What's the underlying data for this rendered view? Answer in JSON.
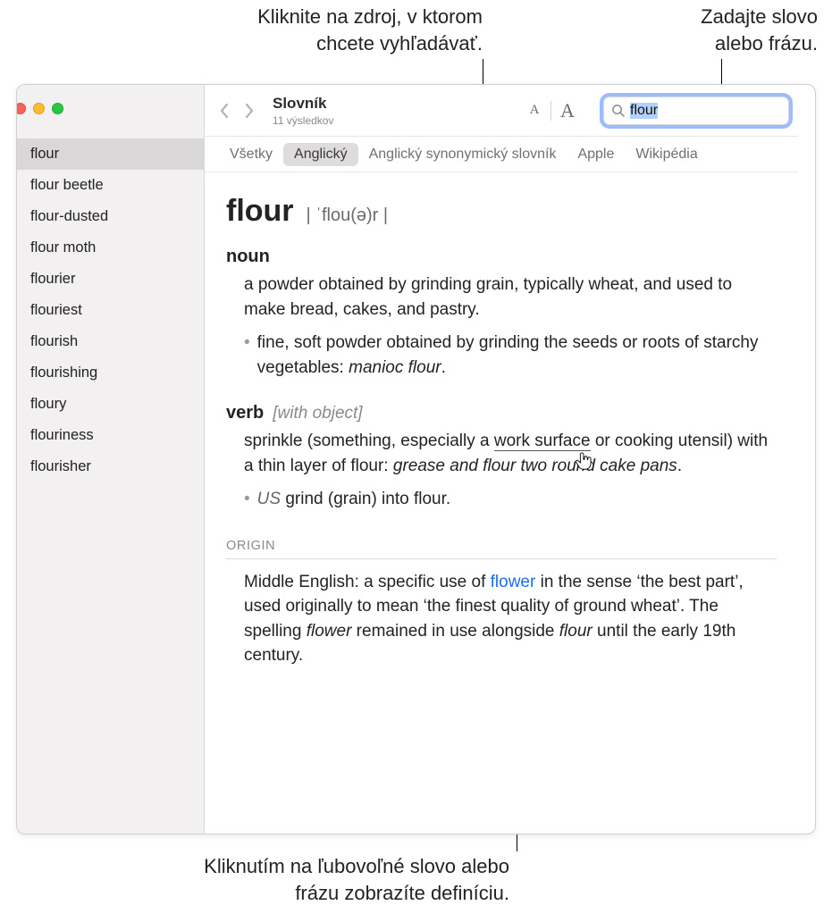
{
  "callouts": {
    "top_left": "Kliknite na zdroj, v ktorom\nchcete vyhľadávať.",
    "top_right": "Zadajte slovo\nalebo frázu.",
    "bottom": "Kliknutím na ľubovoľné slovo alebo\nfrázu zobrazíte definíciu."
  },
  "toolbar": {
    "title": "Slovník",
    "subtitle": "11 výsledkov",
    "font_small": "A",
    "font_large": "A"
  },
  "search": {
    "value": "flour"
  },
  "sources": [
    {
      "label": "Všetky",
      "active": false
    },
    {
      "label": "Anglický",
      "active": true
    },
    {
      "label": "Anglický synonymický slovník",
      "active": false
    },
    {
      "label": "Apple",
      "active": false
    },
    {
      "label": "Wikipédia",
      "active": false
    }
  ],
  "sidebar": {
    "items": [
      {
        "label": "flour",
        "selected": true
      },
      {
        "label": "flour beetle",
        "selected": false
      },
      {
        "label": "flour-dusted",
        "selected": false
      },
      {
        "label": "flour moth",
        "selected": false
      },
      {
        "label": "flourier",
        "selected": false
      },
      {
        "label": "flouriest",
        "selected": false
      },
      {
        "label": "flourish",
        "selected": false
      },
      {
        "label": "flourishing",
        "selected": false
      },
      {
        "label": "floury",
        "selected": false
      },
      {
        "label": "flouriness",
        "selected": false
      },
      {
        "label": "flourisher",
        "selected": false
      }
    ]
  },
  "entry": {
    "headword": "flour",
    "pronunciation": "| ˈflou(ə)r |",
    "blocks": [
      {
        "pos": "noun",
        "qualifier": "",
        "sense": "a powder obtained by grinding grain, typically wheat, and used to make bread, cakes, and pastry.",
        "subs": [
          {
            "lead": "",
            "text": "fine, soft powder obtained by grinding the seeds or roots of starchy vegetables: ",
            "example": "manioc flour",
            "tail": "."
          }
        ]
      },
      {
        "pos": "verb",
        "qualifier": "[with object]",
        "sense_pre": "sprinkle (something, especially a ",
        "sense_link": "work surface",
        "sense_post": " or cooking utensil) with a thin layer of flour: ",
        "sense_example": "grease and flour two round cake pans",
        "sense_tail": ".",
        "subs": [
          {
            "lead": "US ",
            "text": "grind (grain) into flour.",
            "example": "",
            "tail": ""
          }
        ]
      }
    ],
    "origin": {
      "header": "ORIGIN",
      "pre": "Middle English: a specific use of ",
      "link": "flower",
      "mid": " in the sense ‘the best part’, used originally to mean ‘the finest quality of ground wheat’. The spelling ",
      "ital": "flower",
      "post": " remained in use alongside ",
      "ital2": "flour",
      "post2": " until the early 19th century."
    }
  }
}
